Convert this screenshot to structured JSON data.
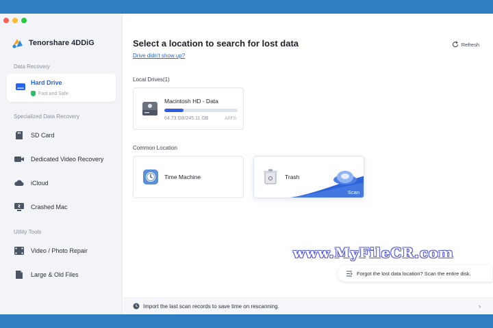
{
  "app": {
    "name": "Tenorshare 4DDiG"
  },
  "sidebar": {
    "sections": {
      "data_recovery": "Data Recovery",
      "specialized": "Specialized Data Recovery",
      "utility": "Utility Tools"
    },
    "active": {
      "label": "Hard Drive",
      "sub": "Fast and Safe"
    },
    "items": [
      {
        "label": "SD Card",
        "icon": "sd-card-icon"
      },
      {
        "label": "Dedicated Video Recovery",
        "icon": "video-camera-icon"
      },
      {
        "label": "iCloud",
        "icon": "cloud-icon"
      },
      {
        "label": "Crashed Mac",
        "icon": "crashed-mac-icon"
      },
      {
        "label": "Video / Photo Repair",
        "icon": "film-repair-icon"
      },
      {
        "label": "Large & Old Files",
        "icon": "files-icon"
      }
    ]
  },
  "main": {
    "title": "Select a location to search for lost data",
    "drive_link": "Drive didn't show up?",
    "refresh": "Refresh",
    "local_label": "Local Drives(1)",
    "drive": {
      "name": "Macintosh HD - Data",
      "size": "64.73 GB/245.11 GB",
      "fs": "APFS",
      "used_fraction": 0.264
    },
    "common_label": "Common Location",
    "locations": [
      {
        "name": "Time Machine"
      },
      {
        "name": "Trash",
        "action": "Scan"
      }
    ],
    "watermark": "www.MyFileCR.com",
    "tip": "Forgot the lost data location? Scan the entire disk.",
    "bottom": "Import the last scan records to save time on rescanning."
  },
  "colors": {
    "accent": "#2563eb",
    "progress": "#2b5fe0",
    "safe": "#2dbd6e"
  }
}
